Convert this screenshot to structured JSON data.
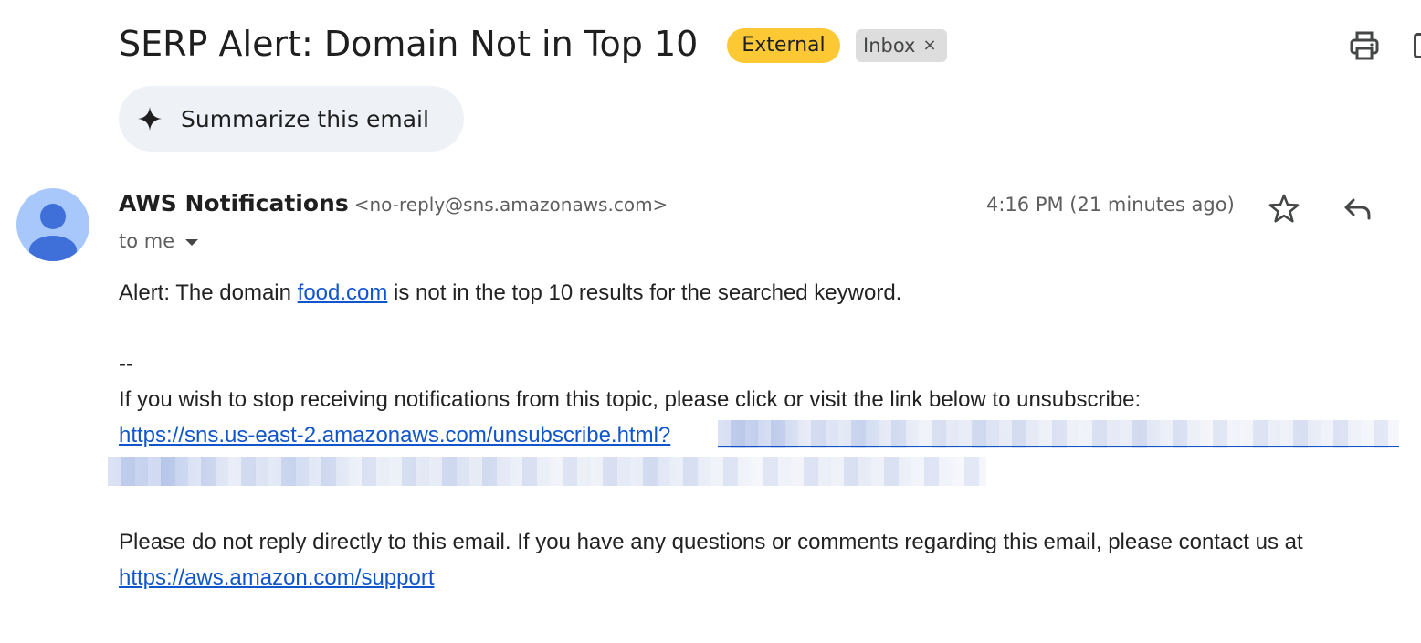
{
  "header": {
    "subject": "SERP Alert: Domain Not in Top 10",
    "labels": {
      "external": "External",
      "inbox": "Inbox",
      "inbox_remove": "×"
    }
  },
  "summarize": {
    "label": "Summarize this email"
  },
  "sender": {
    "name": "AWS Notifications",
    "email": "<no-reply@sns.amazonaws.com>",
    "recipient": "to me",
    "time": "4:16 PM (21 minutes ago)"
  },
  "body": {
    "alert_prefix": "Alert: The domain ",
    "alert_link": "food.com",
    "alert_suffix": " is not in the top 10 results for the searched keyword.",
    "separator": "--",
    "unsubscribe_text": "If you wish to stop receiving notifications from this topic, please click or visit the link below to unsubscribe:",
    "unsubscribe_link": "https://sns.us-east-2.amazonaws.com/unsubscribe.html?",
    "noreply_text": "Please do not reply directly to this email. If you have any questions or comments regarding this email, please contact us at",
    "support_link": "https://aws.amazon.com/support"
  },
  "colors": {
    "external_label": "#fcc934",
    "inbox_label": "#dddddd",
    "link": "#1155cc",
    "avatar": "#a8c7fa"
  },
  "icons": {
    "print": "print-icon",
    "new_window": "open-new-window-icon",
    "sparkle": "sparkle-icon",
    "star": "star-icon",
    "reply": "reply-icon",
    "avatar": "person-avatar-icon",
    "dropdown": "caret-down-icon"
  }
}
